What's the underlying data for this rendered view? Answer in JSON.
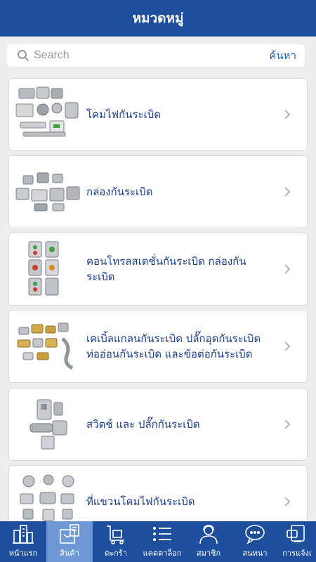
{
  "header": {
    "title": "หมวดหมู่"
  },
  "search": {
    "placeholder": "Search",
    "button_label": "ค้นหา"
  },
  "categories": [
    {
      "label": "โคมไฟกันระเบิด",
      "icon": "explosion-proof-lamp-thumbnail"
    },
    {
      "label": "กล่องกันระเบิด",
      "icon": "explosion-proof-box-thumbnail"
    },
    {
      "label": "คอนโทรลสเตชั่นกันระเบิด กล่องกันระเบิด",
      "icon": "control-station-thumbnail"
    },
    {
      "label": "เคเบิ้ลแกลนกันระเบิด ปลั๊กอุดกันระเบิด ท่ออ่อนกันระเบิด และข้อต่อกันระเบิด",
      "icon": "cable-gland-thumbnail"
    },
    {
      "label": "สวิตช์ และ ปลั๊กกันระเบิด",
      "icon": "switch-plug-thumbnail"
    },
    {
      "label": "ที่แขวนโคมไฟกันระเบิด",
      "icon": "lamp-hanger-thumbnail"
    }
  ],
  "tabbar": {
    "items": [
      {
        "label": "หน้าแรก",
        "icon": "buildings-icon",
        "active": false
      },
      {
        "label": "สินค้า",
        "icon": "product-box-icon",
        "active": true
      },
      {
        "label": "ตะกร้า",
        "icon": "cart-icon",
        "active": false
      },
      {
        "label": "แคตตาล็อก",
        "icon": "list-icon",
        "active": false
      },
      {
        "label": "สมาชิก",
        "icon": "member-icon",
        "active": false
      },
      {
        "label": "สนทนา",
        "icon": "chat-icon",
        "active": false
      },
      {
        "label": "การแจ้งเ",
        "icon": "notification-icon",
        "active": false
      }
    ]
  },
  "colors": {
    "header_bg": "#1d4f9c",
    "active_tab_bg": "#6f97d4",
    "label_text": "#1a3f8f",
    "accent": "#1d63b8"
  }
}
